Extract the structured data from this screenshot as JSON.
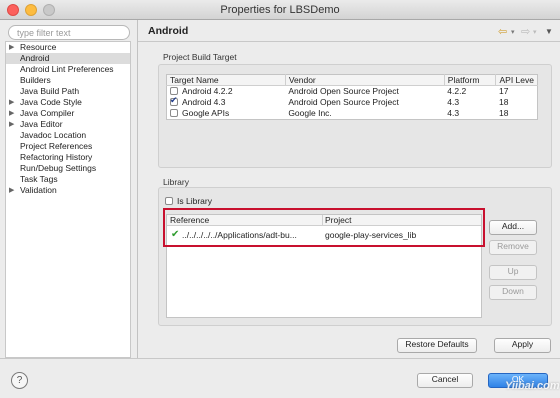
{
  "window": {
    "title": "Properties for LBSDemo"
  },
  "filter": {
    "placeholder": "type filter text"
  },
  "tree": {
    "items": [
      {
        "label": "Resource",
        "expandable": true,
        "selected": false
      },
      {
        "label": "Android",
        "expandable": false,
        "selected": true
      },
      {
        "label": "Android Lint Preferences",
        "expandable": false,
        "selected": false
      },
      {
        "label": "Builders",
        "expandable": false,
        "selected": false
      },
      {
        "label": "Java Build Path",
        "expandable": false,
        "selected": false
      },
      {
        "label": "Java Code Style",
        "expandable": true,
        "selected": false
      },
      {
        "label": "Java Compiler",
        "expandable": true,
        "selected": false
      },
      {
        "label": "Java Editor",
        "expandable": true,
        "selected": false
      },
      {
        "label": "Javadoc Location",
        "expandable": false,
        "selected": false
      },
      {
        "label": "Project References",
        "expandable": false,
        "selected": false
      },
      {
        "label": "Refactoring History",
        "expandable": false,
        "selected": false
      },
      {
        "label": "Run/Debug Settings",
        "expandable": false,
        "selected": false
      },
      {
        "label": "Task Tags",
        "expandable": false,
        "selected": false
      },
      {
        "label": "Validation",
        "expandable": true,
        "selected": false
      }
    ]
  },
  "page": {
    "title": "Android"
  },
  "build_target": {
    "group_label": "Project Build Target",
    "columns": [
      "Target Name",
      "Vendor",
      "Platform",
      "API Leve"
    ],
    "rows": [
      {
        "checked": false,
        "name": "Android 4.2.2",
        "vendor": "Android Open Source Project",
        "platform": "4.2.2",
        "api": "17"
      },
      {
        "checked": true,
        "name": "Android 4.3",
        "vendor": "Android Open Source Project",
        "platform": "4.3",
        "api": "18"
      },
      {
        "checked": false,
        "name": "Google APIs",
        "vendor": "Google Inc.",
        "platform": "4.3",
        "api": "18"
      }
    ]
  },
  "library": {
    "group_label": "Library",
    "is_library_label": "Is Library",
    "is_library_checked": false,
    "columns": [
      "Reference",
      "Project"
    ],
    "rows": [
      {
        "status_icon": "check-icon",
        "reference": "../../../../../Applications/adt-bu...",
        "project": "google-play-services_lib"
      }
    ],
    "buttons": {
      "add": "Add...",
      "remove": "Remove",
      "up": "Up",
      "down": "Down"
    }
  },
  "actions": {
    "restore_defaults": "Restore Defaults",
    "apply": "Apply",
    "cancel": "Cancel",
    "ok": "OK"
  },
  "help": {
    "icon": "help-icon",
    "glyph": "?"
  },
  "watermark": "Yiibai.com",
  "colors": {
    "highlight_box": "#c8102e",
    "default_button": "#2f82e7",
    "selection": "#dcdcdc"
  }
}
